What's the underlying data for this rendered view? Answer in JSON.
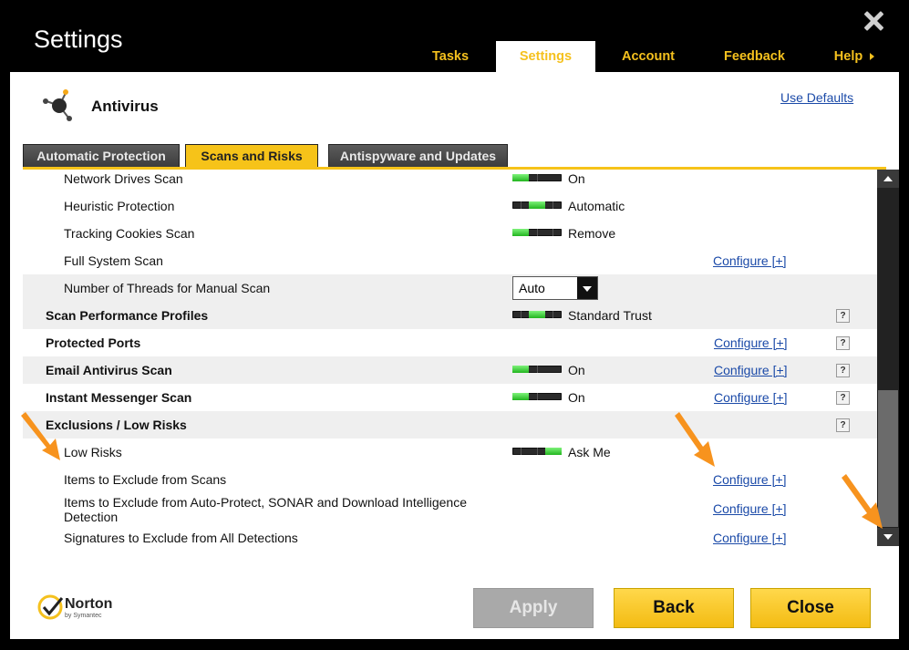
{
  "window": {
    "title": "Settings"
  },
  "nav_tabs": [
    {
      "label": "Tasks"
    },
    {
      "label": "Settings"
    },
    {
      "label": "Account"
    },
    {
      "label": "Feedback"
    },
    {
      "label": "Help"
    }
  ],
  "section": {
    "title": "Antivirus",
    "use_defaults": "Use Defaults"
  },
  "sub_tabs": [
    {
      "label": "Automatic Protection"
    },
    {
      "label": "Scans and Risks"
    },
    {
      "label": "Antispyware and Updates"
    }
  ],
  "rows": [
    {
      "label": "Network Drives Scan",
      "value": "On"
    },
    {
      "label": "Heuristic Protection",
      "value": "Automatic"
    },
    {
      "label": "Tracking Cookies Scan",
      "value": "Remove"
    },
    {
      "label": "Full System Scan",
      "configure": "Configure [+]"
    },
    {
      "label": "Number of Threads for Manual Scan",
      "select_value": "Auto"
    },
    {
      "label": "Scan Performance Profiles",
      "value": "Standard Trust",
      "help": "?"
    },
    {
      "label": "Protected Ports",
      "configure": "Configure [+]",
      "help": "?"
    },
    {
      "label": "Email Antivirus Scan",
      "value": "On",
      "configure": "Configure [+]",
      "help": "?"
    },
    {
      "label": "Instant Messenger Scan",
      "value": "On",
      "configure": "Configure [+]",
      "help": "?"
    },
    {
      "label": "Exclusions / Low Risks",
      "help": "?"
    },
    {
      "label": "Low Risks",
      "value": "Ask Me"
    },
    {
      "label": "Items to Exclude from Scans",
      "configure": "Configure [+]"
    },
    {
      "label": "Items to Exclude from Auto-Protect, SONAR and Download Intelligence Detection",
      "configure": "Configure [+]"
    },
    {
      "label": "Signatures to Exclude from All Detections",
      "configure": "Configure [+]"
    }
  ],
  "brand": {
    "name": "Norton",
    "by": "by Symantec"
  },
  "footer": {
    "apply": "Apply",
    "back": "Back",
    "close": "Close"
  },
  "colors": {
    "accent": "#f5c11e",
    "link": "#1b4aa8",
    "arrow": "#f7931e"
  }
}
